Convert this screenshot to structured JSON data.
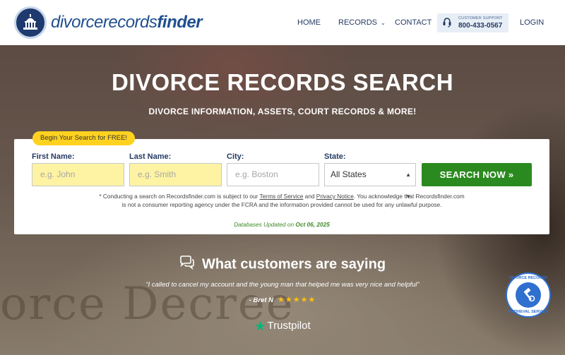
{
  "header": {
    "logo": {
      "text_thin": "divorcerecords",
      "text_bold": "finder"
    },
    "nav": {
      "home": "HOME",
      "records": "RECORDS",
      "contact": "CONTACT",
      "login": "LOGIN"
    },
    "support": {
      "label": "CUSTOMER SUPPORT",
      "phone": "800-433-0567"
    }
  },
  "hero": {
    "title": "DIVORCE RECORDS SEARCH",
    "subtitle": "DIVORCE INFORMATION, ASSETS, COURT RECORDS & MORE!",
    "background_word": "orce Decree"
  },
  "search": {
    "badge": "Begin Your Search for FREE!",
    "first_name": {
      "label": "First Name:",
      "placeholder": "e.g. John"
    },
    "last_name": {
      "label": "Last Name:",
      "placeholder": "e.g. Smith"
    },
    "city": {
      "label": "City:",
      "placeholder": "e.g. Boston"
    },
    "state": {
      "label": "State:",
      "selected": "All States"
    },
    "button": "SEARCH NOW »",
    "disclaimer": {
      "part1": "* Conducting a search on Recordsfinder.com is subject to our ",
      "terms": "Terms of Service",
      "and": " and ",
      "privacy": "Privacy Notice",
      "part2": ". You acknowledge that Recordsfinder.com",
      "line2": "is not a consumer reporting agency under the FCRA and the information provided cannot be used for any unlawful purpose."
    },
    "db_updated": {
      "prefix": "Databases Updated on ",
      "date": "Oct 06, 2025"
    }
  },
  "testimonials": {
    "title": "What customers are saying",
    "quote": "“I called to cancel my account and the young man that helped me was very nice and helpful”",
    "author": "- Bret N",
    "rating": 5,
    "stars": "★★★★★",
    "trustpilot": "Trustpilot"
  },
  "retrieval_badge": {
    "top": "DIVORCE RECORDS",
    "bottom": "RETRIEVAL SERVICE"
  },
  "colors": {
    "brand_blue": "#1f4f8f",
    "nav_text": "#243a63",
    "search_green": "#2b8a1f",
    "badge_yellow": "#ffd21f",
    "input_yellow": "#fdf3a3",
    "star_gold": "#ffc107",
    "trustpilot_green": "#00b67a"
  }
}
